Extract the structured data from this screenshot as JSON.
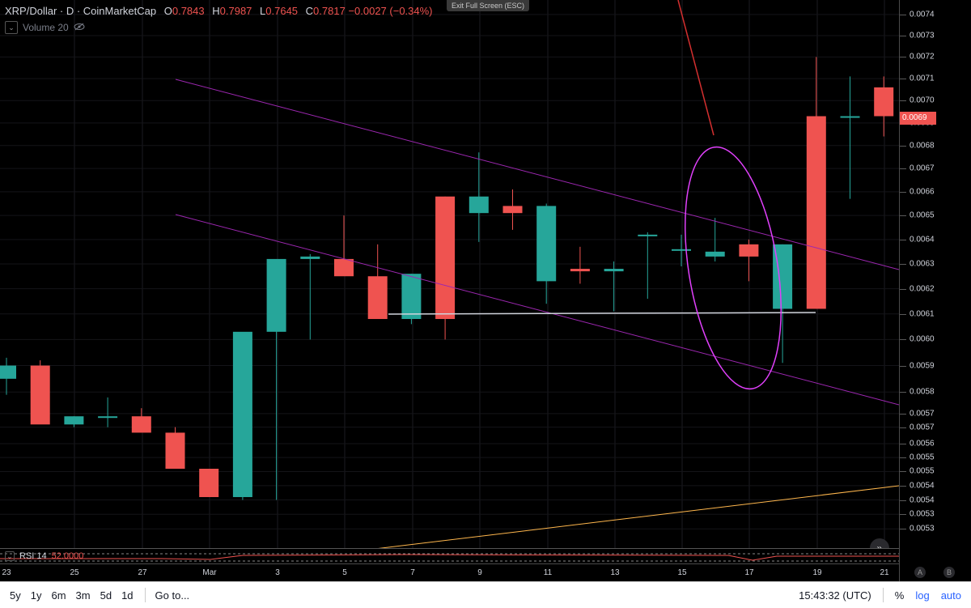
{
  "window": {
    "exit_fullscreen": "Exit Full Screen (ESC)"
  },
  "legend": {
    "symbol": "XRP/Dollar · D · CoinMarketCap",
    "o_key": "O",
    "o_val": "0.7843",
    "h_key": "H",
    "h_val": "0.7987",
    "l_key": "L",
    "l_val": "0.7645",
    "c_key": "C",
    "c_val": "0.7817",
    "change": "−0.0027 (−0.34%)",
    "volume": "Volume 20"
  },
  "rsi": {
    "label": "RSI 14",
    "value": "52.0000"
  },
  "price_axis": {
    "labels": [
      "0.0074",
      "0.0073",
      "0.0072",
      "0.0071",
      "0.0070",
      "0.0069",
      "0.0068",
      "0.0067",
      "0.0066",
      "0.0065",
      "0.0064",
      "0.0063",
      "0.0062",
      "0.0061",
      "0.0060",
      "0.0059",
      "0.0058",
      "0.0057",
      "0.0057",
      "0.0056",
      "0.0055",
      "0.0055",
      "0.0054",
      "0.0054",
      "0.0053",
      "0.0053"
    ],
    "current_price": "0.0069"
  },
  "time_axis": {
    "labels": [
      "23",
      "25",
      "27",
      "Mar",
      "3",
      "5",
      "7",
      "9",
      "11",
      "13",
      "15",
      "17",
      "19",
      "21"
    ]
  },
  "bottom_bar": {
    "ranges": [
      "5y",
      "1y",
      "6m",
      "3m",
      "5d",
      "1d"
    ],
    "goto": "Go to...",
    "clock": "15:43:32 (UTC)",
    "percent": "%",
    "log": "log",
    "auto": "auto"
  },
  "axis_buttons": {
    "a": "A",
    "b": "B"
  },
  "colors": {
    "up": "#26a69a",
    "down": "#ef5350",
    "channel": "#9c27b0",
    "ellipse": "#e040fb",
    "support": "#d1d4dc",
    "arrow": "#d32f2f",
    "trend": "#ffb74d"
  },
  "chart_data": {
    "type": "candlestick",
    "x": [
      "Feb 22",
      "Feb 23",
      "Feb 24",
      "Feb 25",
      "Feb 26",
      "Feb 27",
      "Feb 28",
      "Mar 1",
      "Mar 2",
      "Mar 3",
      "Mar 4",
      "Mar 5",
      "Mar 6",
      "Mar 7",
      "Mar 8",
      "Mar 9",
      "Mar 10",
      "Mar 11",
      "Mar 12",
      "Mar 13",
      "Mar 14",
      "Mar 15",
      "Mar 16",
      "Mar 17",
      "Mar 18",
      "Mar 19",
      "Mar 20",
      "Mar 21"
    ],
    "open": [
      0.00585,
      0.0059,
      0.00568,
      0.00571,
      0.00571,
      0.00565,
      0.00552,
      0.00542,
      0.00603,
      0.00632,
      0.00632,
      0.00625,
      0.00608,
      0.00658,
      0.00651,
      0.00654,
      0.00623,
      0.00628,
      0.00627,
      0.00642,
      0.00636,
      0.00633,
      0.00638,
      0.00612,
      0.00693,
      0.00693,
      0.00706,
      0.00693
    ],
    "high": [
      0.00593,
      0.00592,
      0.00571,
      0.00578,
      0.00574,
      0.00567,
      0.00552,
      0.00543,
      0.00622,
      0.00634,
      0.0065,
      0.00638,
      0.00626,
      0.00658,
      0.00677,
      0.00661,
      0.00655,
      0.00637,
      0.00631,
      0.00643,
      0.00642,
      0.00649,
      0.0064,
      0.00638,
      0.0072,
      0.00711,
      0.00711,
      0.00706
    ],
    "low": [
      0.00579,
      0.00571,
      0.00567,
      0.00567,
      0.00569,
      0.00564,
      0.00546,
      0.00541,
      0.00541,
      0.006,
      0.00629,
      0.00617,
      0.00606,
      0.006,
      0.00639,
      0.00644,
      0.00614,
      0.00622,
      0.00611,
      0.00616,
      0.00629,
      0.00631,
      0.00623,
      0.00591,
      0.00612,
      0.00657,
      0.00684,
      0.00684
    ],
    "close": [
      0.0059,
      0.00568,
      0.00571,
      0.00571,
      0.00565,
      0.00552,
      0.00542,
      0.00603,
      0.00632,
      0.00633,
      0.00625,
      0.00608,
      0.00626,
      0.00608,
      0.00658,
      0.00651,
      0.00654,
      0.00627,
      0.00628,
      0.00642,
      0.00636,
      0.00635,
      0.00633,
      0.00638,
      0.00612,
      0.00693,
      0.00693,
      0.00706
    ]
  }
}
